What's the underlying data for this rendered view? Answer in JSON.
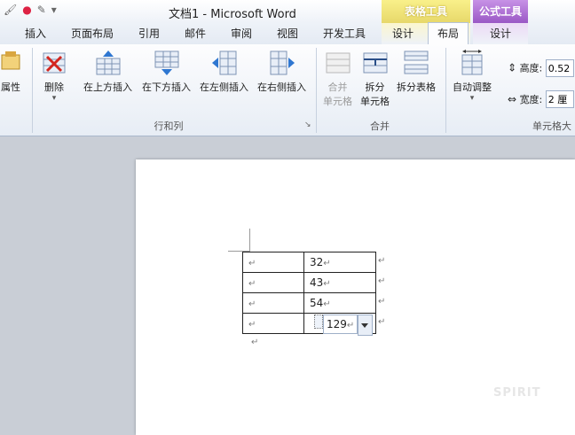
{
  "window": {
    "title": "文档1 - Microsoft Word"
  },
  "context_tabs": {
    "table_tools": "表格工具",
    "formula_tools": "公式工具"
  },
  "tabs": [
    {
      "label": "插入"
    },
    {
      "label": "页面布局"
    },
    {
      "label": "引用"
    },
    {
      "label": "邮件"
    },
    {
      "label": "审阅"
    },
    {
      "label": "视图"
    },
    {
      "label": "开发工具"
    },
    {
      "label": "设计"
    },
    {
      "label": "布局",
      "active": true
    },
    {
      "label": "设计"
    }
  ],
  "ribbon": {
    "properties": "属性",
    "delete": "删除",
    "insert_above": "在上方插入",
    "insert_below": "在下方插入",
    "insert_left": "在左侧插入",
    "insert_right": "在右侧插入",
    "merge_cells_line1": "合并",
    "merge_cells_line2": "单元格",
    "split_cells_line1": "拆分",
    "split_cells_line2": "单元格",
    "split_table": "拆分表格",
    "autofit": "自动调整",
    "height_label": "高度:",
    "height_value": "0.52",
    "width_label": "宽度:",
    "width_value": "2 厘",
    "groups": {
      "rows_cols": "行和列",
      "merge": "合并",
      "cell_size": "单元格大"
    }
  },
  "document": {
    "table": [
      [
        "",
        "32"
      ],
      [
        "",
        "43"
      ],
      [
        "",
        "54"
      ],
      [
        "",
        ""
      ]
    ],
    "field_result": "129",
    "paragraph_mark": "↵"
  },
  "watermark": "SPIRIT",
  "colors": {
    "table_tools_accent": "#e7d86a",
    "formula_tools_accent": "#9a57c5"
  }
}
